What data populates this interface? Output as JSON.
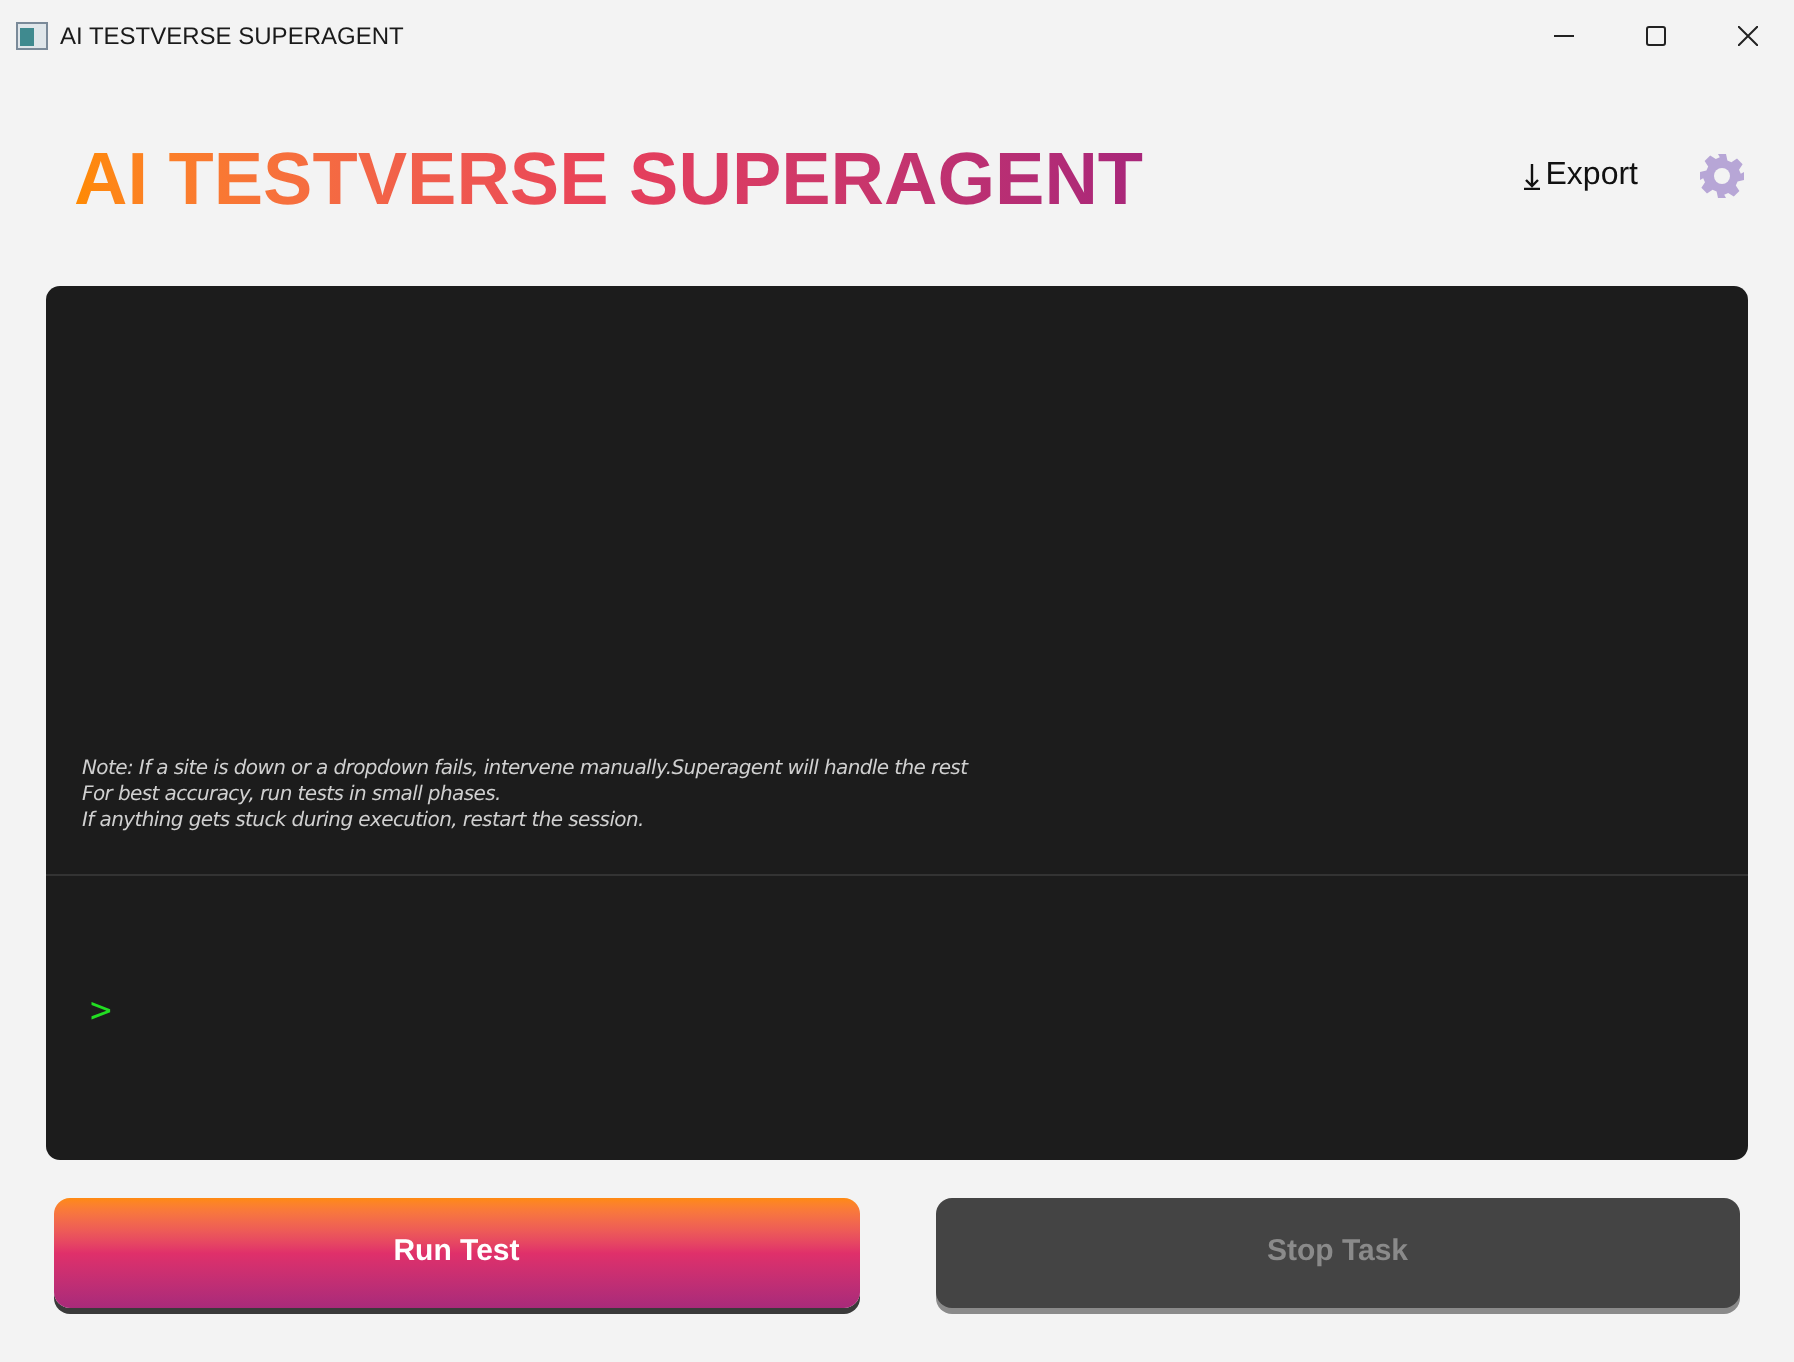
{
  "window": {
    "title": "AI TESTVERSE SUPERAGENT"
  },
  "header": {
    "title": "AI TESTVERSE SUPERAGENT",
    "export_label": "Export"
  },
  "console": {
    "notes": [
      "Note: If a site is down or a dropdown fails, intervene manually.Superagent will handle the rest",
      "For best accuracy, run tests in small phases.",
      "If anything gets stuck during execution, restart the session."
    ],
    "prompt": ">"
  },
  "buttons": [
    {
      "label": "Run Test",
      "kind": "primary",
      "disabled": false
    },
    {
      "label": "Stop Task",
      "kind": "secondary",
      "disabled": true
    }
  ]
}
